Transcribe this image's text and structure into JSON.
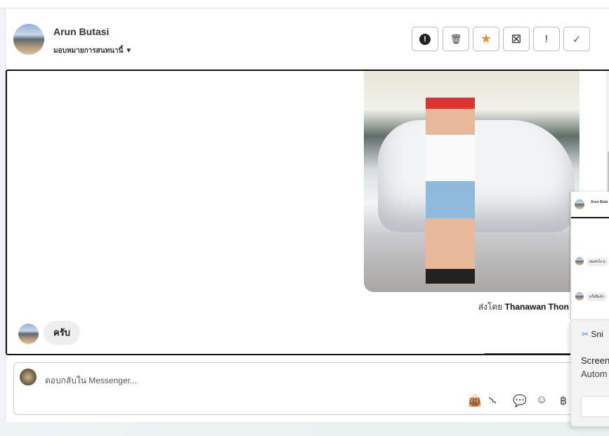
{
  "header": {
    "name": "Arun Butasi",
    "assign": "มอบหมายการสนทนานี้"
  },
  "toolbar": {
    "spam": "⓿",
    "delete": "🗑",
    "star": "★",
    "archive": "⊠",
    "important": "!",
    "done": "✓",
    "star_color": "#f5892b"
  },
  "chat": {
    "sent_by_prefix": "ส่งโดย",
    "sent_by_name": "Thanawan Thon",
    "reply": "ครับ"
  },
  "composer": {
    "placeholder": "ตอบกลับใน Messenger..."
  },
  "mini_chat": {
    "name": "Arun Buta",
    "msg1": "ผมสนใจ น",
    "msg2": "ครั้งที่แล้ว"
  },
  "toast": {
    "app": "Sni",
    "line1": "Screen",
    "line2": "Autom"
  }
}
